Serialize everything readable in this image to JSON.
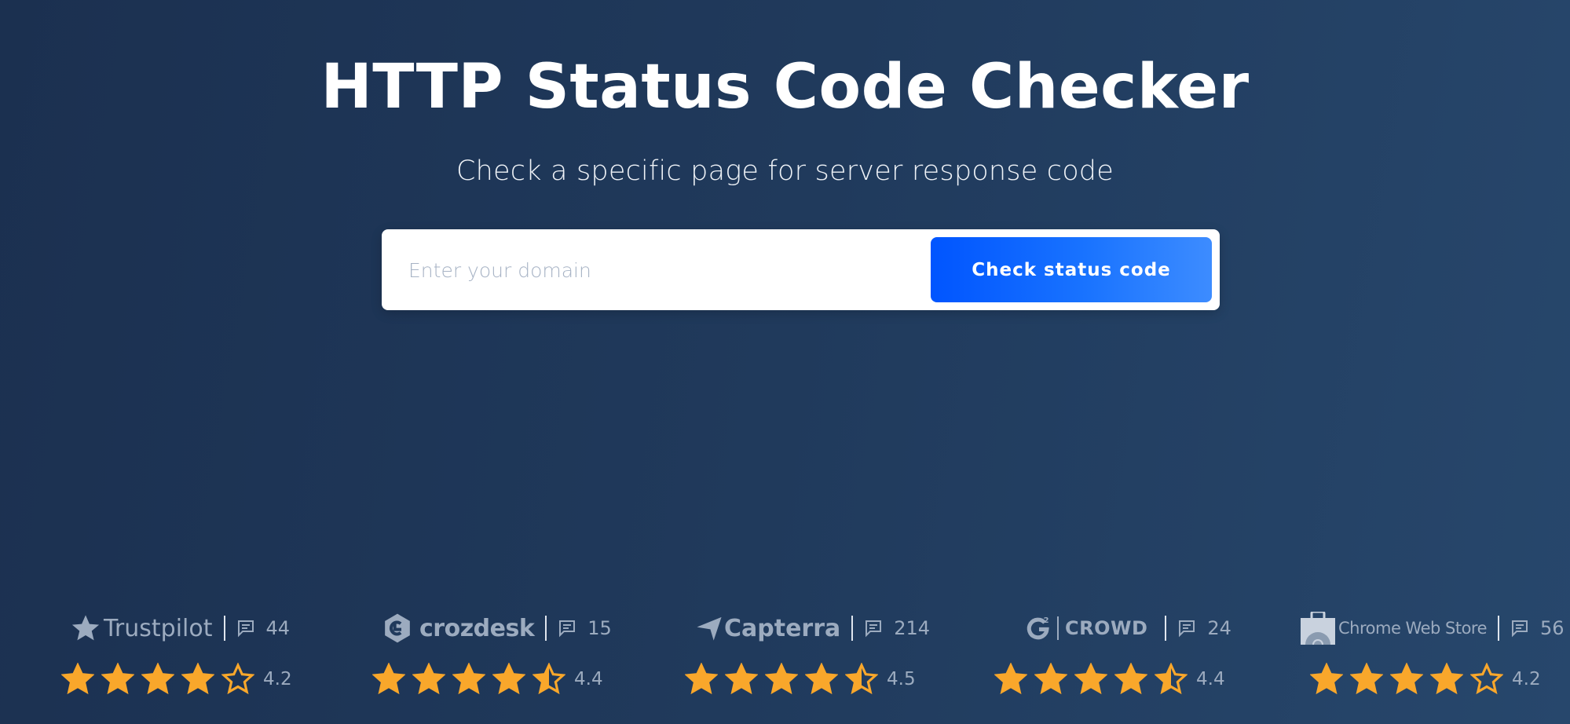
{
  "hero": {
    "title": "HTTP Status Code Checker",
    "subtitle": "Check a specific page for server response code"
  },
  "search": {
    "placeholder": "Enter your domain",
    "value": "",
    "button_label": "Check status code"
  },
  "colors": {
    "star": "#f9a72b",
    "brand_gray": "#9cabbf",
    "button_start": "#0055ff",
    "button_end": "#3d8cff"
  },
  "reviews": [
    {
      "platform": "Trustpilot",
      "icon": "trustpilot-star-icon",
      "count": "44",
      "rating": "4.2",
      "stars": 4.2
    },
    {
      "platform": "crozdesk",
      "icon": "crozdesk-logo-icon",
      "count": "15",
      "rating": "4.4",
      "stars": 4.4
    },
    {
      "platform": "Capterra",
      "icon": "capterra-logo-icon",
      "count": "214",
      "rating": "4.5",
      "stars": 4.5
    },
    {
      "platform": "CROWD",
      "icon": "g2-logo-icon",
      "count": "24",
      "rating": "4.4",
      "stars": 4.4
    },
    {
      "platform": "Chrome Web Store",
      "icon": "chrome-web-store-icon",
      "count": "56",
      "rating": "4.2",
      "stars": 4.2
    }
  ]
}
